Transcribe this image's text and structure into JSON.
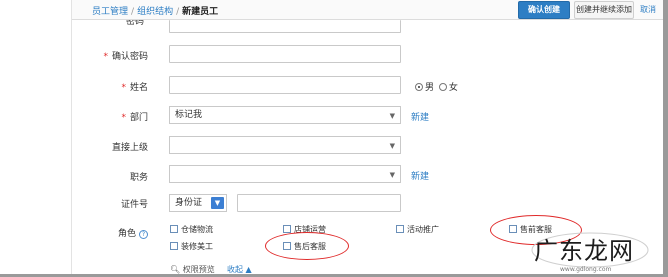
{
  "breadcrumb": {
    "level1": "员工管理",
    "sep": "/",
    "level2": "组织结构",
    "current": "新建员工"
  },
  "header_actions": {
    "confirm_create": "确认创建",
    "create_and_continue": "创建并继续添加",
    "cancel": "取消"
  },
  "form": {
    "password_label_partial": "密码",
    "confirm_password_label": "确认密码",
    "name_label": "姓名",
    "gender": {
      "male": "男",
      "female": "女",
      "selected": "男"
    },
    "department_label": "部门",
    "department_value": "标记我",
    "department_new": "新建",
    "supervisor_label": "直接上级",
    "position_label": "职务",
    "position_new": "新建",
    "id_label": "证件号",
    "id_type_value": "身份证",
    "role_label": "角色",
    "roles": [
      {
        "label": "仓储物流"
      },
      {
        "label": "店铺运营"
      },
      {
        "label": "活动推广"
      },
      {
        "label": "售前客服"
      },
      {
        "label": "装修美工"
      },
      {
        "label": "售后客服"
      }
    ],
    "permission_preview": "权限预览",
    "collapse": "收起"
  },
  "colors": {
    "link": "#2d7ec4",
    "primary_button": "#2d7ec4",
    "required_mark": "#e02a2a",
    "annotation": "#e02a2a"
  },
  "watermark": {
    "text": "广东龙网",
    "url": "www.gdlong.com"
  }
}
